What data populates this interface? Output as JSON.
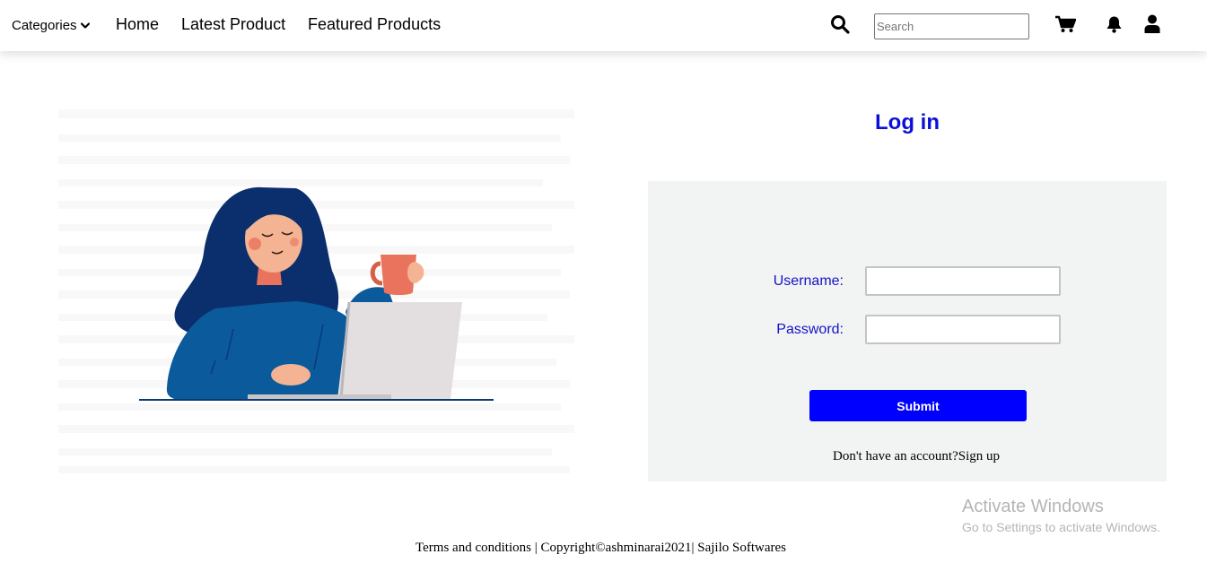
{
  "nav": {
    "categories_label": "Categories",
    "links": [
      "Home",
      "Latest Product",
      "Featured Products"
    ],
    "search_placeholder": "Search",
    "icons": [
      "search-icon",
      "cart-icon",
      "bell-icon",
      "user-icon"
    ]
  },
  "login": {
    "title": "Log in",
    "username_label": "Username:",
    "password_label": "Password:",
    "submit_label": "Submit",
    "signup_prompt": "Don't have an account?",
    "signup_link": "Sign up"
  },
  "watermark": {
    "title": "Activate Windows",
    "subtitle": "Go to Settings to activate Windows."
  },
  "footer": {
    "text": "Terms and conditions | Copyright©ashminarai2021| Sajilo Softwares"
  },
  "colors": {
    "accent_blue": "#0000ff",
    "title_blue": "#0a10d8",
    "panel_bg": "#f2f3f3"
  }
}
